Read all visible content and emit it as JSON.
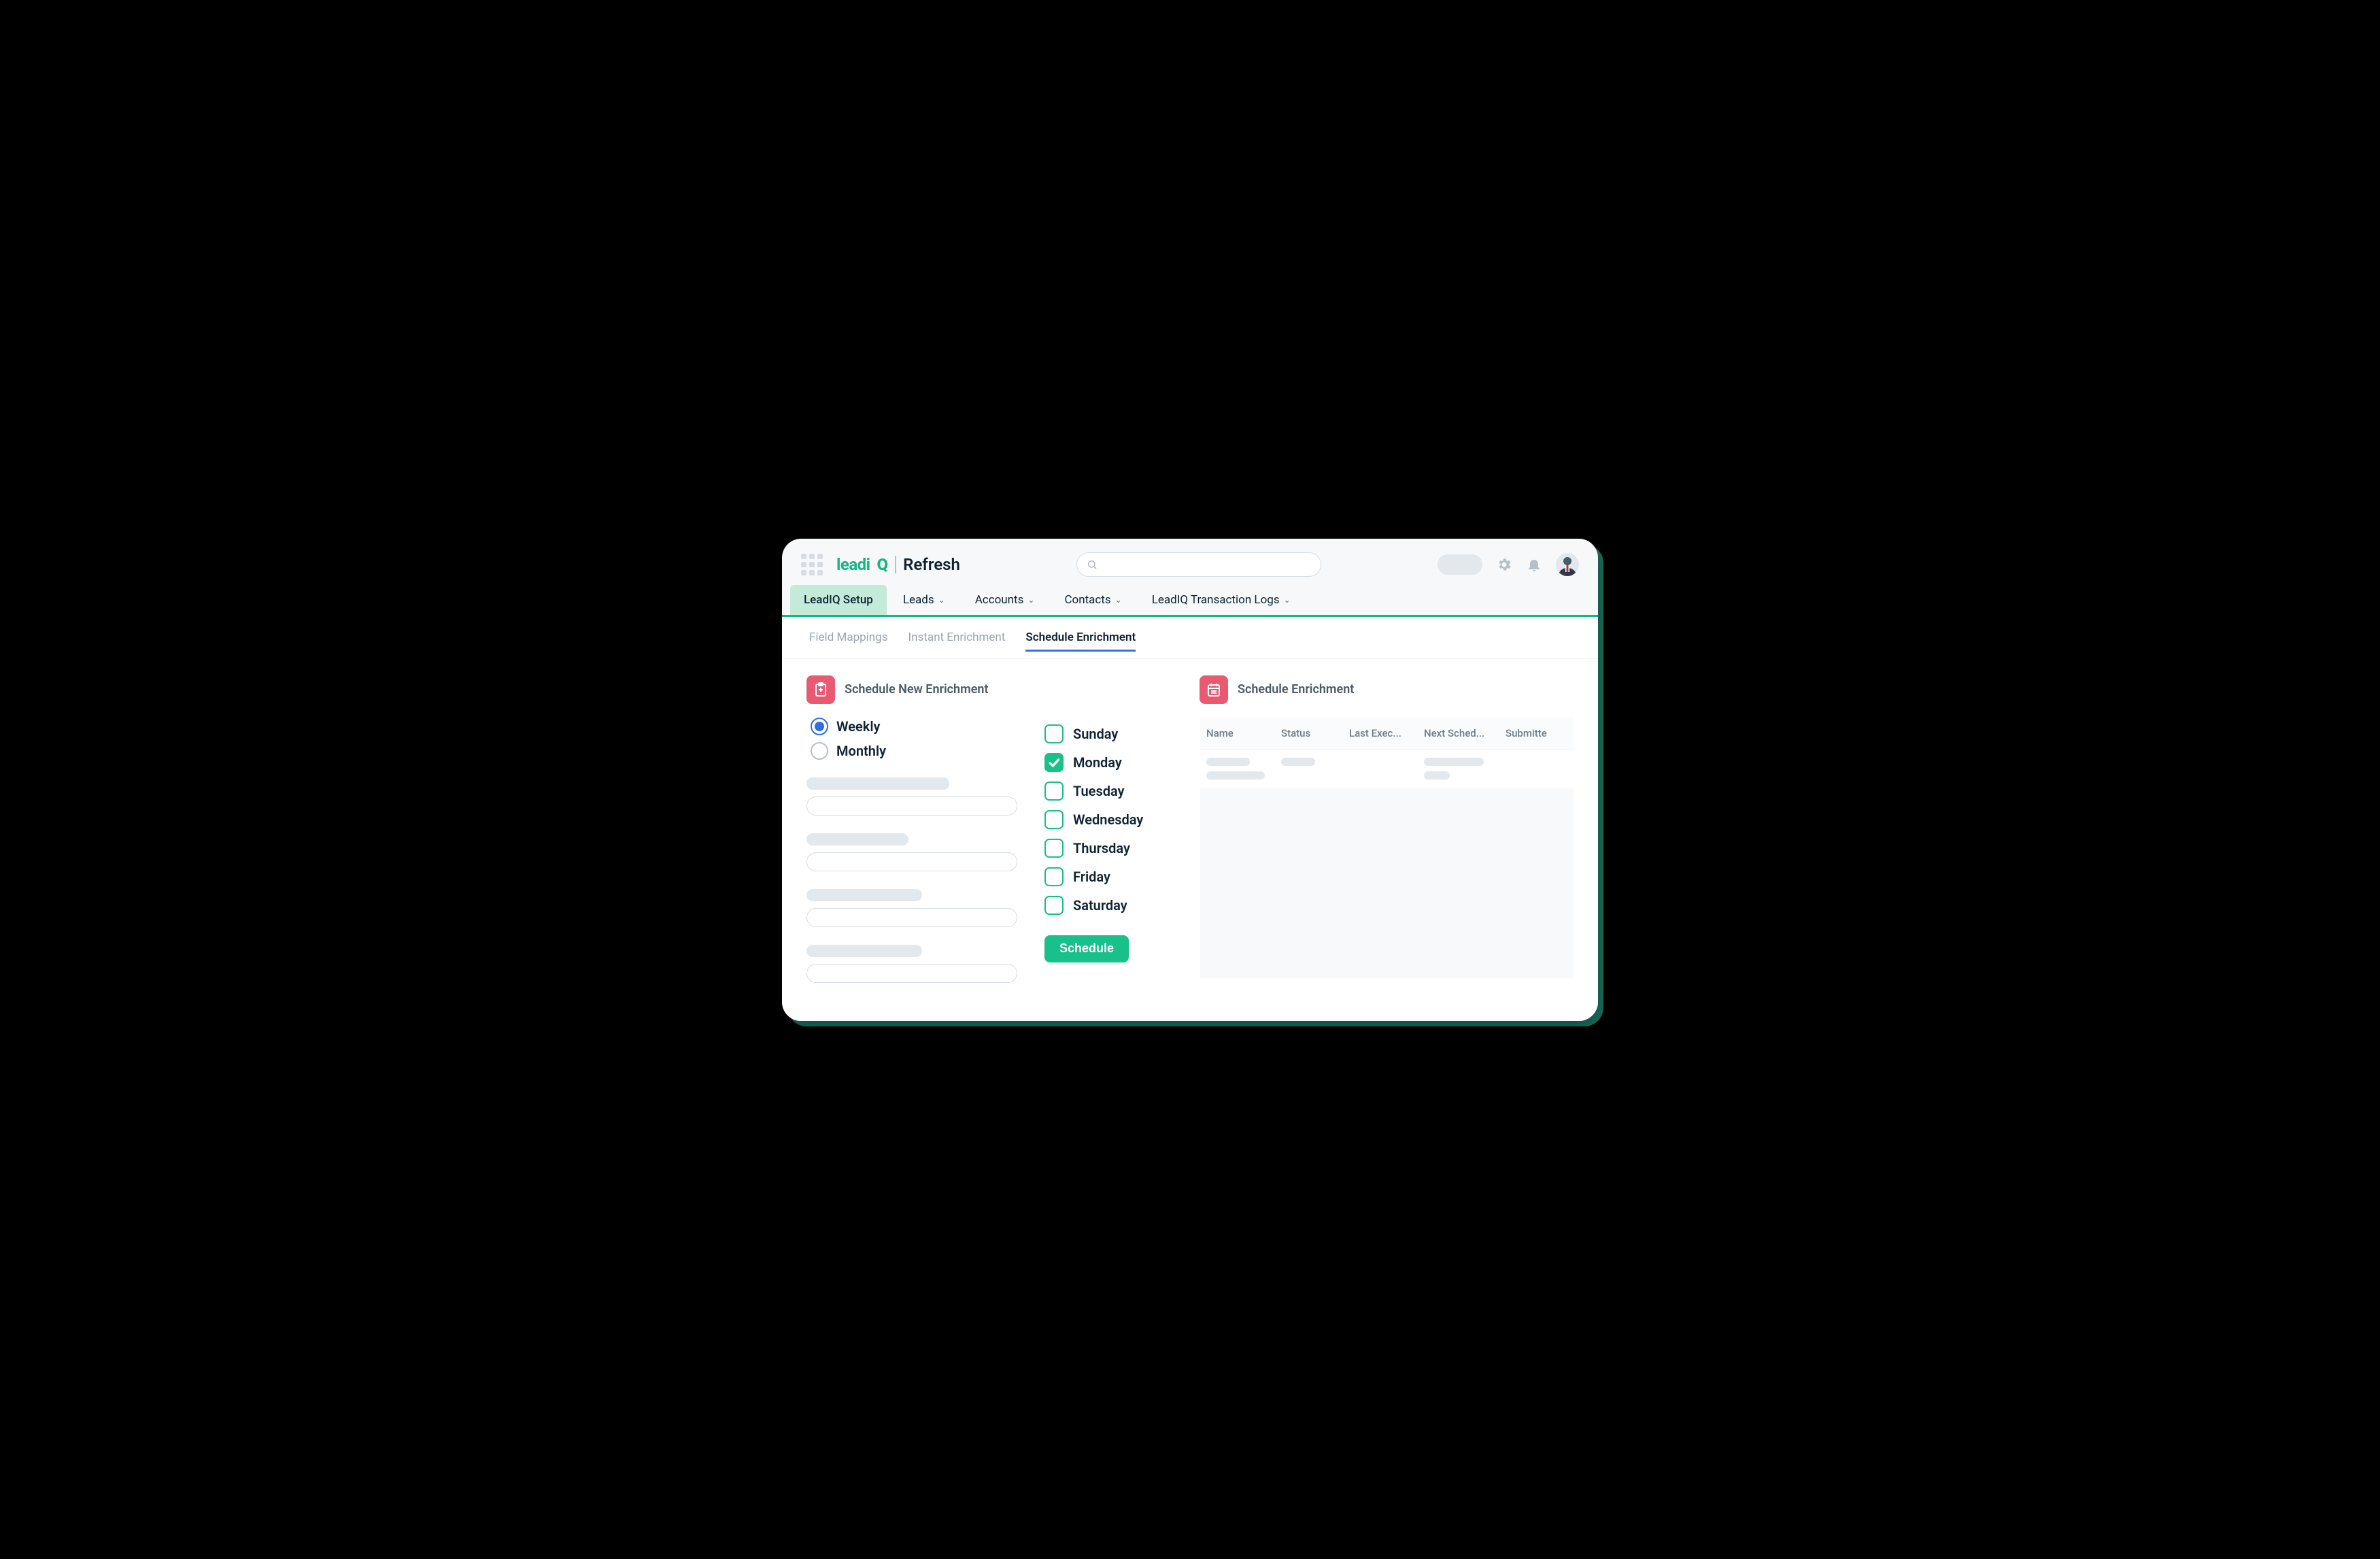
{
  "brand": {
    "leadi": "leadi",
    "q": "Q",
    "product": "Refresh"
  },
  "nav": {
    "items": [
      {
        "label": "LeadIQ Setup",
        "active": true,
        "has_menu": false
      },
      {
        "label": "Leads",
        "active": false,
        "has_menu": true
      },
      {
        "label": "Accounts",
        "active": false,
        "has_menu": true
      },
      {
        "label": "Contacts",
        "active": false,
        "has_menu": true
      },
      {
        "label": "LeadIQ Transaction Logs",
        "active": false,
        "has_menu": true
      }
    ]
  },
  "subtabs": [
    {
      "label": "Field Mappings",
      "active": false
    },
    {
      "label": "Instant Enrichment",
      "active": false
    },
    {
      "label": "Schedule Enrichment",
      "active": true
    }
  ],
  "left_panel": {
    "title": "Schedule New Enrichment",
    "frequency": {
      "options": [
        {
          "label": "Weekly",
          "selected": true
        },
        {
          "label": "Monthly",
          "selected": false
        }
      ]
    },
    "days": [
      {
        "label": "Sunday",
        "checked": false
      },
      {
        "label": "Monday",
        "checked": true
      },
      {
        "label": "Tuesday",
        "checked": false
      },
      {
        "label": "Wednesday",
        "checked": false
      },
      {
        "label": "Thursday",
        "checked": false
      },
      {
        "label": "Friday",
        "checked": false
      },
      {
        "label": "Saturday",
        "checked": false
      }
    ],
    "schedule_button": "Schedule"
  },
  "right_panel": {
    "title": "Schedule Enrichment",
    "columns": [
      "Name",
      "Status",
      "Last Exec...",
      "Next Sched...",
      "Submitte"
    ]
  }
}
